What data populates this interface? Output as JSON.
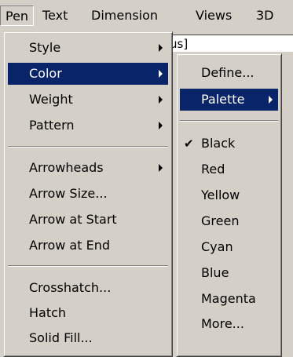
{
  "menubar": {
    "items": [
      "Pen",
      "Text",
      "Dimension",
      "Views",
      "3D"
    ]
  },
  "background": {
    "field_text": "us]"
  },
  "pen_menu": {
    "items": [
      {
        "label": "Style"
      },
      {
        "label": "Color"
      },
      {
        "label": "Weight"
      },
      {
        "label": "Pattern"
      },
      {
        "label": "Arrowheads"
      },
      {
        "label": "Arrow Size..."
      },
      {
        "label": "Arrow at Start"
      },
      {
        "label": "Arrow at End"
      },
      {
        "label": "Crosshatch..."
      },
      {
        "label": "Hatch"
      },
      {
        "label": "Solid Fill..."
      }
    ]
  },
  "color_menu": {
    "items": [
      {
        "label": "Define..."
      },
      {
        "label": "Palette"
      },
      {
        "label": "Black"
      },
      {
        "label": "Red"
      },
      {
        "label": "Yellow"
      },
      {
        "label": "Green"
      },
      {
        "label": "Cyan"
      },
      {
        "label": "Blue"
      },
      {
        "label": "Magenta"
      },
      {
        "label": "More..."
      }
    ],
    "checked_item": "Black",
    "check_glyph": "✔"
  },
  "colors": {
    "menu_background": "#d4d0c8",
    "highlight_background": "#0a246a",
    "highlight_text": "#ffffff"
  }
}
